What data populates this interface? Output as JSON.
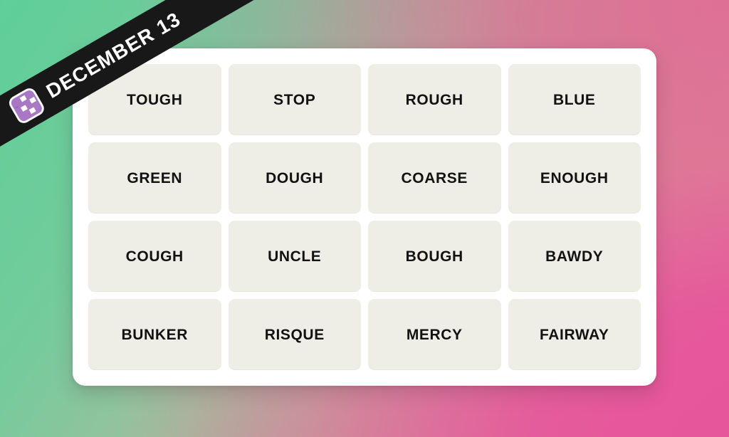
{
  "ribbon": {
    "date_label": "DECEMBER 13",
    "icon": "puzzle-grid-icon",
    "background_color": "#181818",
    "text_color": "#ffffff",
    "icon_colors": {
      "fill": "#a978c4",
      "blank": "#ffffff",
      "outline": "#181818"
    }
  },
  "background": {
    "gradient_start_color": "#5fcf99",
    "gradient_mid_color": "#c49a9f",
    "gradient_end_color": "#e6569b"
  },
  "card": {
    "background_color": "#ffffff",
    "tile_color": "#eeeee6",
    "tile_text_color": "#121212"
  },
  "grid": {
    "columns": 4,
    "rows": 4,
    "tiles": [
      {
        "label": "TOUGH"
      },
      {
        "label": "STOP"
      },
      {
        "label": "ROUGH"
      },
      {
        "label": "BLUE"
      },
      {
        "label": "GREEN"
      },
      {
        "label": "DOUGH"
      },
      {
        "label": "COARSE"
      },
      {
        "label": "ENOUGH"
      },
      {
        "label": "COUGH"
      },
      {
        "label": "UNCLE"
      },
      {
        "label": "BOUGH"
      },
      {
        "label": "BAWDY"
      },
      {
        "label": "BUNKER"
      },
      {
        "label": "RISQUE"
      },
      {
        "label": "MERCY"
      },
      {
        "label": "FAIRWAY"
      }
    ]
  }
}
